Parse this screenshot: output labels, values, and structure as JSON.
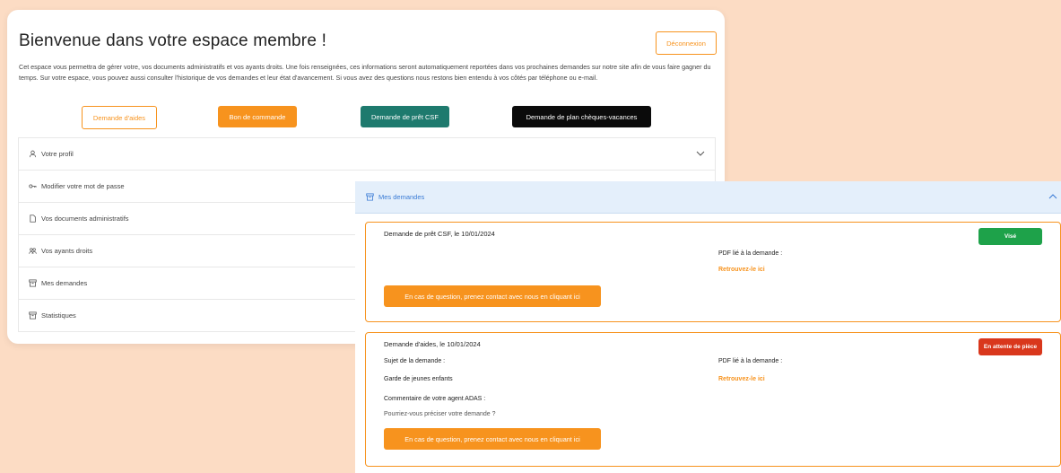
{
  "header": {
    "title": "Bienvenue dans votre espace membre !",
    "logout_label": "Déconnexion",
    "intro": "Cet espace vous permettra de gérer votre, vos documents administratifs et vos ayants droits. Une fois renseignées, ces informations seront automatiquement reportées dans vos prochaines demandes sur notre site afin de vous faire gagner du temps. Sur votre espace, vous pouvez aussi consulter l'historique de vos demandes et leur état d'avancement. Si vous avez des questions nous restons bien entendu à vos côtés par téléphone ou e-mail."
  },
  "actions": {
    "aides": "Demande d'aides",
    "commande": "Bon de commande",
    "pret": "Demande de prêt CSF",
    "cheques": "Demande de plan chèques-vacances"
  },
  "accordion": {
    "items": [
      {
        "label": "Votre profil",
        "icon": "user-icon"
      },
      {
        "label": "Modifier votre mot de passe",
        "icon": "key-icon"
      },
      {
        "label": "Vos documents administratifs",
        "icon": "document-icon"
      },
      {
        "label": "Vos ayants droits",
        "icon": "users-icon"
      },
      {
        "label": "Mes demandes",
        "icon": "archive-icon"
      },
      {
        "label": "Statistiques",
        "icon": "archive-icon"
      }
    ]
  },
  "panel": {
    "title": "Mes demandes",
    "requests": [
      {
        "title": "Demande de prêt CSF, le 10/01/2024",
        "status": "Visé",
        "status_color": "#1ea24a",
        "pdf_label": "PDF lié à la demande :",
        "pdf_link": "Retrouvez-le ici",
        "cta": "En cas de question, prenez contact avec nous en cliquant ici"
      },
      {
        "title": "Demande d'aides, le 10/01/2024",
        "status": "En attente de pièce",
        "status_color": "#d9371c",
        "subject_label": "Sujet de la demande :",
        "subject_value": "Garde de jeunes enfants",
        "pdf_label": "PDF lié à la demande :",
        "pdf_link": "Retrouvez-le ici",
        "comment_label": "Commentaire de votre agent ADAS :",
        "comment_value": "Pourriez-vous préciser votre demande ?",
        "cta": "En cas de question, prenez contact avec nous en cliquant ici"
      }
    ]
  },
  "colors": {
    "accent": "#f7931e",
    "teal": "#1e7a6e",
    "background": "#fcdcc4",
    "panel_header": "#e4effb"
  }
}
